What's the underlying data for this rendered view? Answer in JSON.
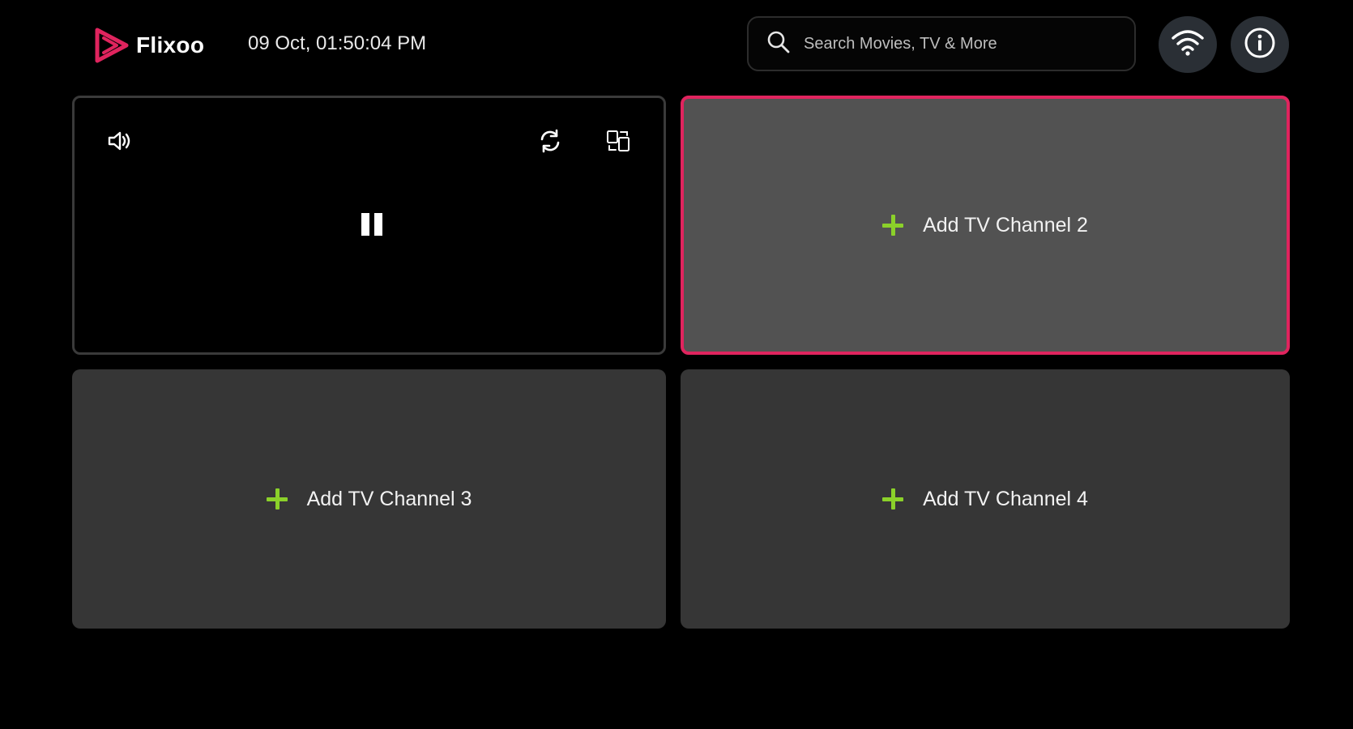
{
  "header": {
    "logo_text": "Flixoo",
    "datetime": "09 Oct, 01:50:04 PM",
    "search_placeholder": "Search Movies, TV & More"
  },
  "icons": {
    "logo": "flixoo-play-logo-icon",
    "search": "search-icon",
    "wifi": "wifi-icon",
    "info": "info-icon",
    "volume": "volume-icon",
    "refresh": "refresh-icon",
    "switch": "switch-layout-icon",
    "pause": "pause-icon",
    "add": "plus-icon"
  },
  "tiles": {
    "channel2": "Add TV Channel 2",
    "channel3": "Add TV Channel 3",
    "channel4": "Add TV Channel 4"
  },
  "colors": {
    "background": "#000000",
    "accent": "#e0245e",
    "add_icon": "#8bd12a",
    "tile_focused": "#525252",
    "tile": "#363636"
  }
}
